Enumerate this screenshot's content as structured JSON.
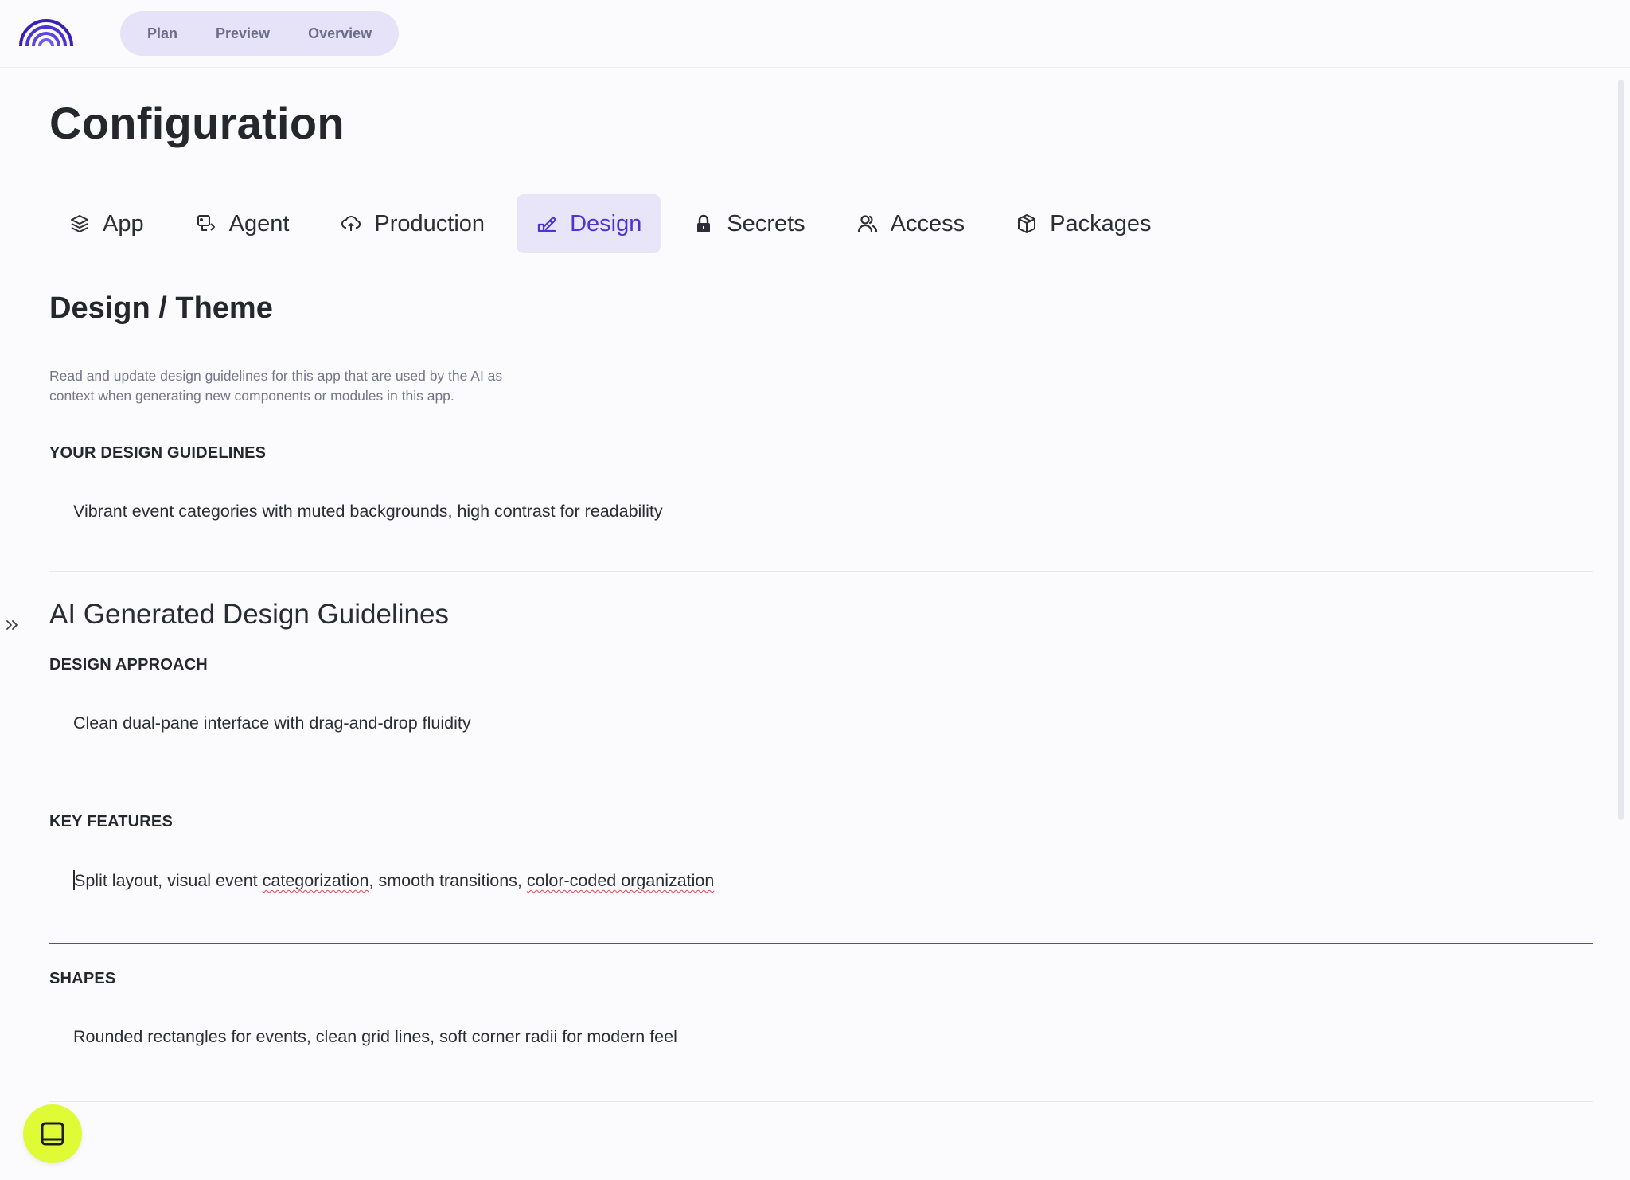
{
  "header": {
    "logo_name": "rainbow-logo",
    "mode_tabs": [
      {
        "label": "Plan"
      },
      {
        "label": "Preview"
      },
      {
        "label": "Overview"
      }
    ]
  },
  "page": {
    "title": "Configuration"
  },
  "tabs": [
    {
      "label": "App",
      "icon": "stack-icon"
    },
    {
      "label": "Agent",
      "icon": "agent-icon"
    },
    {
      "label": "Production",
      "icon": "cloud-icon"
    },
    {
      "label": "Design",
      "icon": "design-icon",
      "active": true
    },
    {
      "label": "Secrets",
      "icon": "lock-icon"
    },
    {
      "label": "Access",
      "icon": "users-icon"
    },
    {
      "label": "Packages",
      "icon": "package-icon"
    }
  ],
  "design": {
    "title": "Design / Theme",
    "description": "Read and update design guidelines for this app that are used by the AI as context when generating new components or modules in this app.",
    "your_guidelines": {
      "label": "YOUR DESIGN GUIDELINES",
      "value": "Vibrant event categories with muted backgrounds, high contrast for readability"
    },
    "ai_heading": "AI Generated Design Guidelines",
    "approach": {
      "label": "DESIGN APPROACH",
      "value": "Clean dual-pane interface with drag-and-drop fluidity"
    },
    "key_features": {
      "label": "KEY FEATURES",
      "value_parts": [
        "Split layout, visual event ",
        "categorization",
        ", smooth transitions, ",
        "color-coded organization"
      ]
    },
    "shapes": {
      "label": "SHAPES",
      "value": "Rounded rectangles for events, clean grid lines, soft corner radii for modern feel"
    }
  },
  "colors": {
    "accent": "#4a34d4",
    "accent_bg": "#e8e5f8",
    "mode_switch_bg": "#e6e2f7",
    "chat_button": "#dffb36",
    "background": "#fbfbfd"
  },
  "floating": {
    "expand_icon": "double-chevron-right-icon",
    "chat_icon": "chat-icon"
  }
}
